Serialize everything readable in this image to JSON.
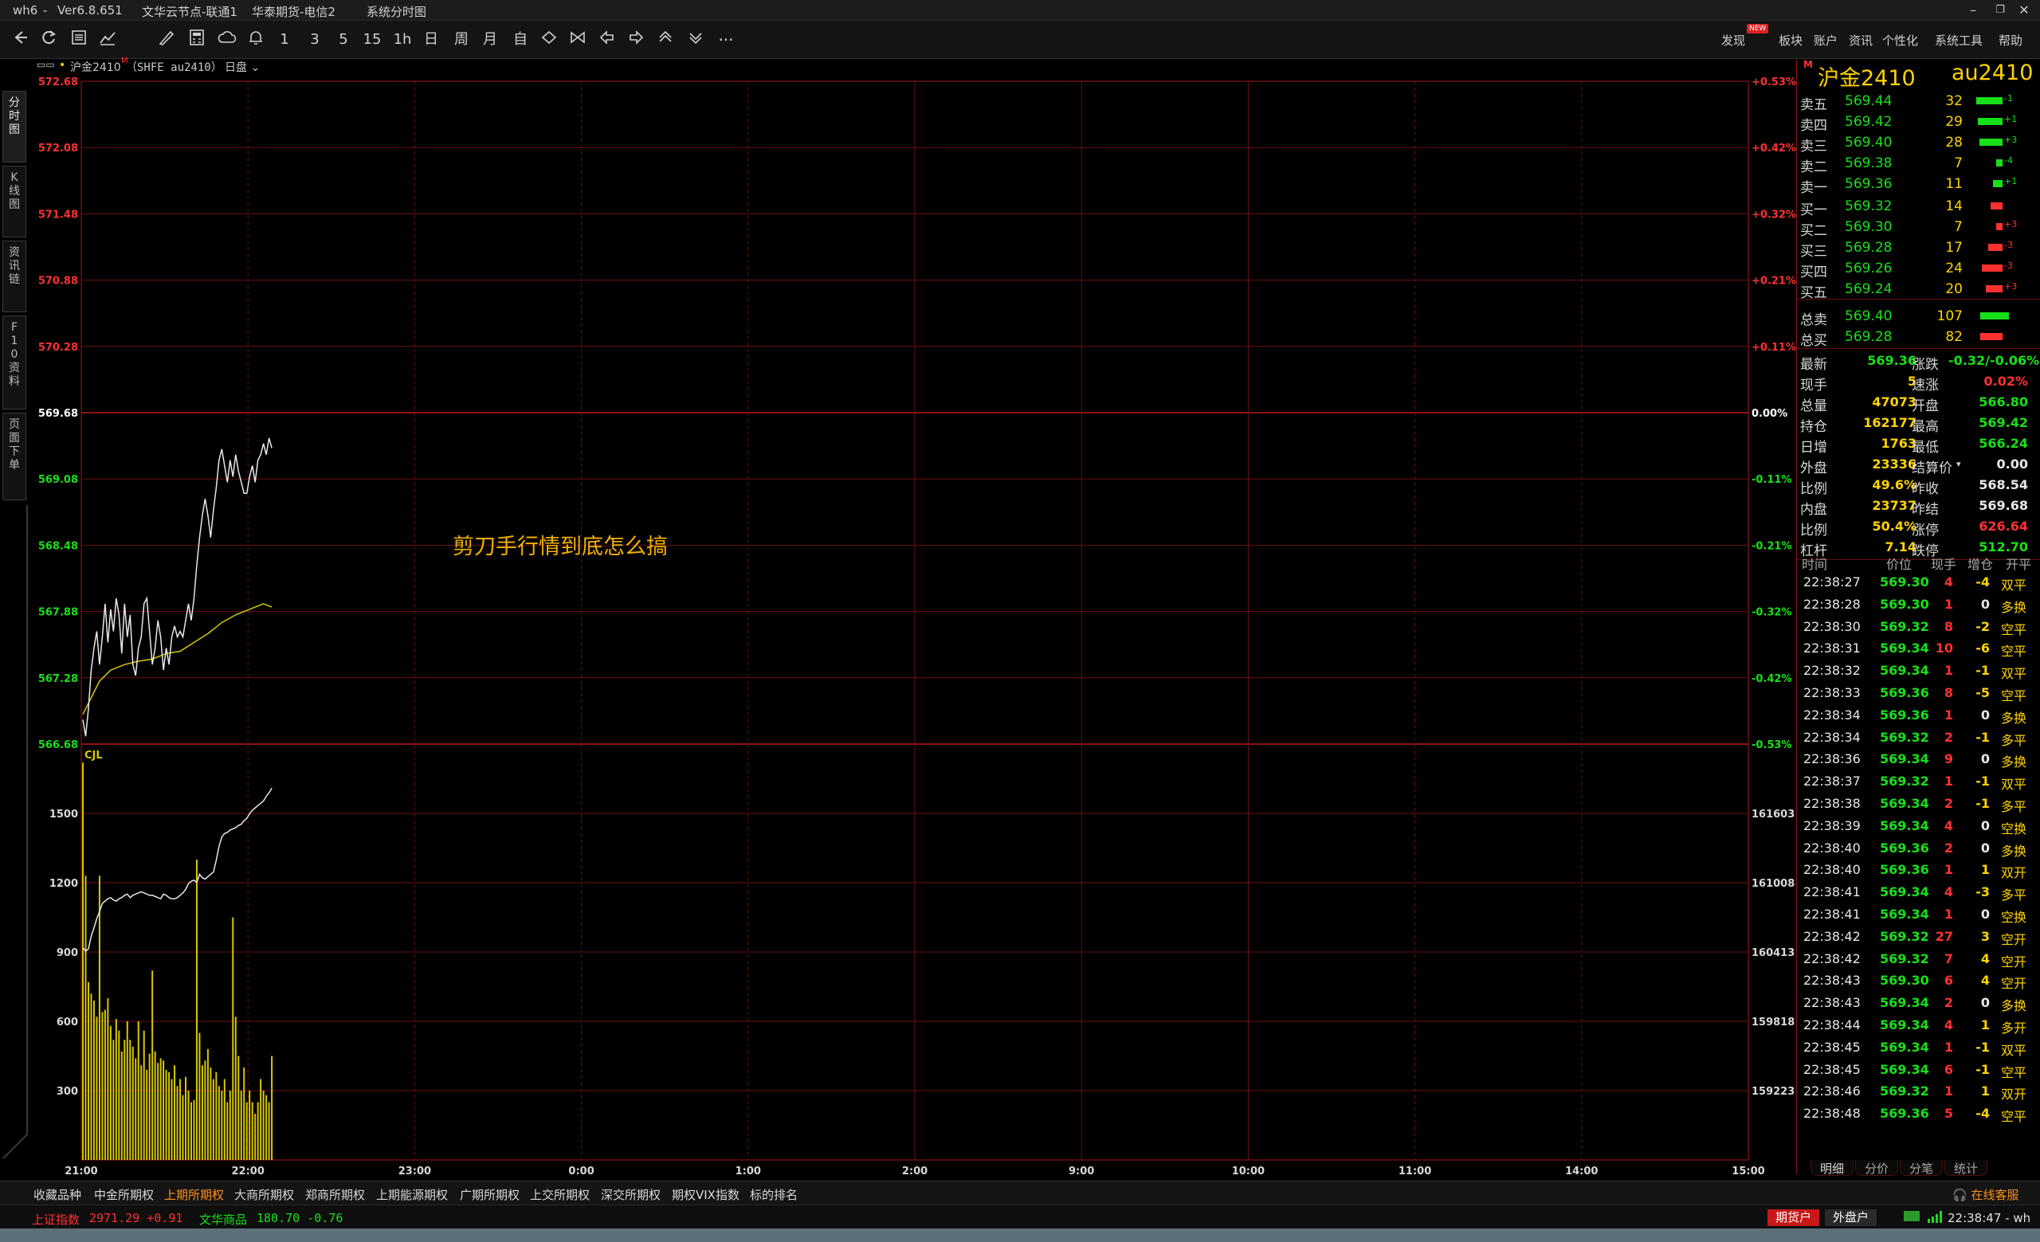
{
  "titlebar": {
    "app": "wh6",
    "version": "Ver6.8.651",
    "server": "文华云节点-联通1",
    "broker": "华泰期货-电信2",
    "view": "系统分时图",
    "buttons": [
      "–",
      "❐",
      "✕"
    ]
  },
  "toolbar": {
    "icons": [
      "back-arrow-icon",
      "refresh-icon",
      "list-icon",
      "line-chart-icon",
      "draw-icon",
      "calculator-icon",
      "cloud-icon",
      "bell-icon"
    ],
    "periods": [
      "1",
      "3",
      "5",
      "15",
      "1h",
      "日",
      "周",
      "月",
      "自"
    ],
    "more": "···",
    "menu": [
      "发现",
      "板块",
      "账户",
      "资讯",
      "个性化",
      "系统工具",
      "帮助"
    ],
    "new_badge": "NEW"
  },
  "left_tabs": [
    "分\n时\n图",
    "K\n线\n图",
    "资\n讯\n链",
    "F\n1\n0\n资\n料",
    "页\n面\n下\n单"
  ],
  "chart_header": {
    "icon_text": "▭▭",
    "symbol": "沪金2410",
    "superscript": "M",
    "exchange_code": "（SHFE au2410）",
    "session": "日盘"
  },
  "annotation": "剪刀手行情到底怎么搞",
  "chart_data": {
    "type": "line",
    "title": "沪金2410",
    "price_axis": {
      "ticks": [
        "572.68",
        "572.08",
        "571.48",
        "570.88",
        "570.28",
        "569.68",
        "569.08",
        "568.48",
        "567.88",
        "567.28",
        "566.68"
      ],
      "ylim": [
        566.68,
        572.68
      ],
      "prev_settle": 569.68
    },
    "pct_axis": {
      "ticks": [
        "+0.53%",
        "+0.42%",
        "+0.32%",
        "+0.21%",
        "+0.11%",
        "0.00%",
        "-0.11%",
        "-0.21%",
        "-0.32%",
        "-0.42%",
        "-0.53%"
      ]
    },
    "volume_axis": {
      "ticks": [
        "1500",
        "1200",
        "900",
        "600",
        "300"
      ],
      "label": "CJL",
      "ylim": [
        0,
        1800
      ]
    },
    "oi_axis": {
      "ticks": [
        "161603",
        "161008",
        "160413",
        "159818",
        "159223"
      ]
    },
    "time_axis": [
      "21:00",
      "22:00",
      "23:00",
      "0:00",
      "1:00",
      "2:00",
      "9:00",
      "10:00",
      "11:00",
      "14:00",
      "15:00"
    ],
    "price_series": [
      [
        0,
        566.9
      ],
      [
        1,
        566.75
      ],
      [
        2,
        567.0
      ],
      [
        3,
        567.35
      ],
      [
        4,
        567.55
      ],
      [
        5,
        567.7
      ],
      [
        6,
        567.4
      ],
      [
        7,
        567.65
      ],
      [
        8,
        567.95
      ],
      [
        9,
        567.6
      ],
      [
        10,
        567.9
      ],
      [
        11,
        567.7
      ],
      [
        12,
        568.0
      ],
      [
        13,
        567.85
      ],
      [
        14,
        567.5
      ],
      [
        15,
        567.95
      ],
      [
        16,
        567.65
      ],
      [
        17,
        567.85
      ],
      [
        18,
        567.4
      ],
      [
        19,
        567.3
      ],
      [
        20,
        567.55
      ],
      [
        21,
        567.65
      ],
      [
        22,
        567.95
      ],
      [
        23,
        568.0
      ],
      [
        24,
        567.7
      ],
      [
        25,
        567.4
      ],
      [
        26,
        567.55
      ],
      [
        27,
        567.8
      ],
      [
        28,
        567.65
      ],
      [
        29,
        567.35
      ],
      [
        30,
        567.55
      ],
      [
        31,
        567.4
      ],
      [
        32,
        567.65
      ],
      [
        33,
        567.75
      ],
      [
        34,
        567.65
      ],
      [
        35,
        567.7
      ],
      [
        36,
        567.65
      ],
      [
        37,
        567.8
      ],
      [
        38,
        567.95
      ],
      [
        39,
        567.8
      ],
      [
        40,
        568.0
      ],
      [
        41,
        568.3
      ],
      [
        42,
        568.55
      ],
      [
        43,
        568.75
      ],
      [
        44,
        568.9
      ],
      [
        45,
        568.75
      ],
      [
        46,
        568.55
      ],
      [
        47,
        568.8
      ],
      [
        48,
        569.0
      ],
      [
        49,
        569.25
      ],
      [
        50,
        569.35
      ],
      [
        51,
        569.2
      ],
      [
        52,
        569.05
      ],
      [
        53,
        569.25
      ],
      [
        54,
        569.1
      ],
      [
        55,
        569.3
      ],
      [
        56,
        569.15
      ],
      [
        57,
        569.05
      ],
      [
        58,
        568.95
      ],
      [
        59,
        568.95
      ],
      [
        60,
        569.1
      ],
      [
        61,
        569.2
      ],
      [
        62,
        569.05
      ],
      [
        63,
        569.25
      ],
      [
        64,
        569.3
      ],
      [
        65,
        569.4
      ],
      [
        66,
        569.3
      ],
      [
        67,
        569.45
      ],
      [
        68,
        569.36
      ]
    ],
    "avg_series": [
      [
        0,
        566.95
      ],
      [
        3,
        567.1
      ],
      [
        6,
        567.25
      ],
      [
        10,
        567.35
      ],
      [
        15,
        567.4
      ],
      [
        20,
        567.43
      ],
      [
        25,
        567.45
      ],
      [
        30,
        567.5
      ],
      [
        35,
        567.52
      ],
      [
        40,
        567.6
      ],
      [
        45,
        567.68
      ],
      [
        50,
        567.78
      ],
      [
        55,
        567.85
      ],
      [
        60,
        567.9
      ],
      [
        65,
        567.95
      ],
      [
        68,
        567.92
      ]
    ],
    "oi_series": [
      [
        0,
        160450
      ],
      [
        1,
        160420
      ],
      [
        2,
        160440
      ],
      [
        3,
        160550
      ],
      [
        4,
        160620
      ],
      [
        5,
        160700
      ],
      [
        6,
        160760
      ],
      [
        7,
        160830
      ],
      [
        8,
        160850
      ],
      [
        9,
        160870
      ],
      [
        10,
        160880
      ],
      [
        11,
        160860
      ],
      [
        12,
        160850
      ],
      [
        13,
        160870
      ],
      [
        14,
        160880
      ],
      [
        15,
        160900
      ],
      [
        16,
        160910
      ],
      [
        17,
        160880
      ],
      [
        18,
        160900
      ],
      [
        19,
        160910
      ],
      [
        20,
        160920
      ],
      [
        21,
        160930
      ],
      [
        22,
        160920
      ],
      [
        23,
        160910
      ],
      [
        24,
        160900
      ],
      [
        25,
        160900
      ],
      [
        26,
        160890
      ],
      [
        27,
        160880
      ],
      [
        28,
        160870
      ],
      [
        29,
        160910
      ],
      [
        30,
        160900
      ],
      [
        31,
        160880
      ],
      [
        32,
        160870
      ],
      [
        33,
        160870
      ],
      [
        34,
        160880
      ],
      [
        35,
        160900
      ],
      [
        36,
        160920
      ],
      [
        37,
        160950
      ],
      [
        38,
        161000
      ],
      [
        39,
        161020
      ],
      [
        40,
        161030
      ],
      [
        41,
        161010
      ],
      [
        42,
        161080
      ],
      [
        43,
        161050
      ],
      [
        44,
        161040
      ],
      [
        45,
        161060
      ],
      [
        46,
        161080
      ],
      [
        47,
        161100
      ],
      [
        48,
        161200
      ],
      [
        49,
        161320
      ],
      [
        50,
        161400
      ],
      [
        51,
        161430
      ],
      [
        52,
        161440
      ],
      [
        53,
        161460
      ],
      [
        54,
        161470
      ],
      [
        55,
        161480
      ],
      [
        56,
        161500
      ],
      [
        57,
        161510
      ],
      [
        58,
        161540
      ],
      [
        59,
        161560
      ],
      [
        60,
        161600
      ],
      [
        61,
        161630
      ],
      [
        62,
        161650
      ],
      [
        63,
        161670
      ],
      [
        64,
        161690
      ],
      [
        65,
        161710
      ],
      [
        66,
        161750
      ],
      [
        67,
        161780
      ],
      [
        68,
        161820
      ]
    ],
    "volume": [
      1720,
      1230,
      770,
      720,
      690,
      620,
      1230,
      640,
      650,
      700,
      580,
      520,
      610,
      560,
      470,
      520,
      600,
      520,
      490,
      440,
      600,
      410,
      560,
      390,
      460,
      820,
      470,
      420,
      440,
      430,
      390,
      380,
      350,
      410,
      320,
      350,
      280,
      360,
      300,
      250,
      260,
      1300,
      550,
      410,
      430,
      480,
      400,
      350,
      380,
      320,
      300,
      350,
      250,
      300,
      1050,
      620,
      450,
      300,
      400,
      250,
      300,
      250,
      200,
      250,
      350,
      300,
      280,
      250,
      450
    ]
  },
  "quote_panel": {
    "name": "沪金2410",
    "code": "au2410",
    "m_badge": "M",
    "asks": [
      {
        "label": "卖五",
        "price": "569.44",
        "vol": "32",
        "chg": "-1",
        "bar": 0.52
      },
      {
        "label": "卖四",
        "price": "569.42",
        "vol": "29",
        "chg": "+1",
        "bar": 0.48
      },
      {
        "label": "卖三",
        "price": "569.40",
        "vol": "28",
        "chg": "+3",
        "bar": 0.46
      },
      {
        "label": "卖二",
        "price": "569.38",
        "vol": "7",
        "chg": "-4",
        "bar": 0.12
      },
      {
        "label": "卖一",
        "price": "569.36",
        "vol": "11",
        "chg": "+1",
        "bar": 0.18
      }
    ],
    "bids": [
      {
        "label": "买一",
        "price": "569.32",
        "vol": "14",
        "chg": "",
        "bar": 0.23
      },
      {
        "label": "买二",
        "price": "569.30",
        "vol": "7",
        "chg": "+3",
        "bar": 0.12
      },
      {
        "label": "买三",
        "price": "569.28",
        "vol": "17",
        "chg": "-3",
        "bar": 0.28
      },
      {
        "label": "买四",
        "price": "569.26",
        "vol": "24",
        "chg": "-3",
        "bar": 0.4
      },
      {
        "label": "买五",
        "price": "569.24",
        "vol": "20",
        "chg": "+3",
        "bar": 0.33
      }
    ],
    "totals": [
      {
        "label": "总卖",
        "price": "569.40",
        "vol": "107",
        "bar": 1.0,
        "color": "green"
      },
      {
        "label": "总买",
        "price": "569.28",
        "vol": "82",
        "bar": 0.77,
        "color": "red"
      }
    ],
    "stats": [
      {
        "l1": "最新",
        "v1": "569.36",
        "c1": "green",
        "l2": "涨跌",
        "v2": "-0.32/-0.06%",
        "c2": "green"
      },
      {
        "l1": "现手",
        "v1": "5",
        "c1": "yellow",
        "l2": "速涨",
        "v2": "0.02%",
        "c2": "red"
      },
      {
        "l1": "总量",
        "v1": "47073",
        "c1": "yellow",
        "l2": "开盘",
        "v2": "566.80",
        "c2": "green"
      },
      {
        "l1": "持仓",
        "v1": "162177",
        "c1": "yellow",
        "l2": "最高",
        "v2": "569.42",
        "c2": "green"
      },
      {
        "l1": "日增",
        "v1": "1763",
        "c1": "yellow",
        "l2": "最低",
        "v2": "566.24",
        "c2": "green"
      },
      {
        "l1": "外盘",
        "v1": "23336",
        "c1": "yellow",
        "l2": "结算价",
        "v2": "0.00",
        "c2": "white"
      },
      {
        "l1": "比例",
        "v1": "49.6%",
        "c1": "yellow",
        "l2": "昨收",
        "v2": "568.54",
        "c2": "white"
      },
      {
        "l1": "内盘",
        "v1": "23737",
        "c1": "yellow",
        "l2": "昨结",
        "v2": "569.68",
        "c2": "white"
      },
      {
        "l1": "比例",
        "v1": "50.4%",
        "c1": "yellow",
        "l2": "涨停",
        "v2": "626.64",
        "c2": "red"
      },
      {
        "l1": "杠杆",
        "v1": "7.14",
        "c1": "yellow",
        "l2": "跌停",
        "v2": "512.70",
        "c2": "green"
      }
    ],
    "tick_header": [
      "时间",
      "价位",
      "现手",
      "增仓",
      "开平"
    ],
    "ticks": [
      {
        "t": "22:38:27",
        "p": "569.30",
        "v": "4",
        "d": "-4",
        "o": "双平"
      },
      {
        "t": "22:38:28",
        "p": "569.30",
        "v": "1",
        "d": "0",
        "o": "多换"
      },
      {
        "t": "22:38:30",
        "p": "569.32",
        "v": "8",
        "d": "-2",
        "o": "空平"
      },
      {
        "t": "22:38:31",
        "p": "569.34",
        "v": "10",
        "d": "-6",
        "o": "空平"
      },
      {
        "t": "22:38:32",
        "p": "569.34",
        "v": "1",
        "d": "-1",
        "o": "双平"
      },
      {
        "t": "22:38:33",
        "p": "569.36",
        "v": "8",
        "d": "-5",
        "o": "空平"
      },
      {
        "t": "22:38:34",
        "p": "569.36",
        "v": "1",
        "d": "0",
        "o": "多换"
      },
      {
        "t": "22:38:34",
        "p": "569.32",
        "v": "2",
        "d": "-1",
        "o": "多平"
      },
      {
        "t": "22:38:36",
        "p": "569.34",
        "v": "9",
        "d": "0",
        "o": "多换"
      },
      {
        "t": "22:38:37",
        "p": "569.32",
        "v": "1",
        "d": "-1",
        "o": "双平"
      },
      {
        "t": "22:38:38",
        "p": "569.34",
        "v": "2",
        "d": "-1",
        "o": "多平"
      },
      {
        "t": "22:38:39",
        "p": "569.34",
        "v": "4",
        "d": "0",
        "o": "空换"
      },
      {
        "t": "22:38:40",
        "p": "569.36",
        "v": "2",
        "d": "0",
        "o": "多换"
      },
      {
        "t": "22:38:40",
        "p": "569.36",
        "v": "1",
        "d": "1",
        "o": "双开"
      },
      {
        "t": "22:38:41",
        "p": "569.34",
        "v": "4",
        "d": "-3",
        "o": "多平"
      },
      {
        "t": "22:38:41",
        "p": "569.34",
        "v": "1",
        "d": "0",
        "o": "空换"
      },
      {
        "t": "22:38:42",
        "p": "569.32",
        "v": "27",
        "d": "3",
        "o": "空开"
      },
      {
        "t": "22:38:42",
        "p": "569.32",
        "v": "7",
        "d": "4",
        "o": "空开"
      },
      {
        "t": "22:38:43",
        "p": "569.30",
        "v": "6",
        "d": "4",
        "o": "空开"
      },
      {
        "t": "22:38:43",
        "p": "569.34",
        "v": "2",
        "d": "0",
        "o": "多换"
      },
      {
        "t": "22:38:44",
        "p": "569.34",
        "v": "4",
        "d": "1",
        "o": "多开"
      },
      {
        "t": "22:38:45",
        "p": "569.34",
        "v": "1",
        "d": "-1",
        "o": "双平"
      },
      {
        "t": "22:38:45",
        "p": "569.34",
        "v": "6",
        "d": "-1",
        "o": "空平"
      },
      {
        "t": "22:38:46",
        "p": "569.32",
        "v": "1",
        "d": "1",
        "o": "双开"
      },
      {
        "t": "22:38:48",
        "p": "569.36",
        "v": "5",
        "d": "-4",
        "o": "空平"
      }
    ],
    "tabs": [
      "明细",
      "分价",
      "分笔",
      "统计"
    ]
  },
  "bottom_tabs": {
    "items": [
      "收藏品种",
      "中金所期权",
      "上期所期权",
      "大商所期权",
      "郑商所期权",
      "上期能源期权",
      "广期所期权",
      "上交所期权",
      "深交所期权",
      "期权VIX指数",
      "标的排名"
    ],
    "active_index": 2,
    "service": "在线客服"
  },
  "status_bar": {
    "index1_name": "上证指数",
    "index1_value": "2971.29 +0.91",
    "index2_name": "文华商品",
    "index2_value": "180.70 -0.76",
    "btn_futures": "期货户",
    "btn_outer": "外盘户",
    "clock": "22:38:47 - wh"
  },
  "colors": {
    "grid": "#6e0f0f",
    "up": "#ff3030",
    "down": "#18e018",
    "price_line": "#e8e8e8",
    "avg_line": "#d8c800",
    "volume": "#d8c800",
    "active_tab": "#ff9020"
  }
}
